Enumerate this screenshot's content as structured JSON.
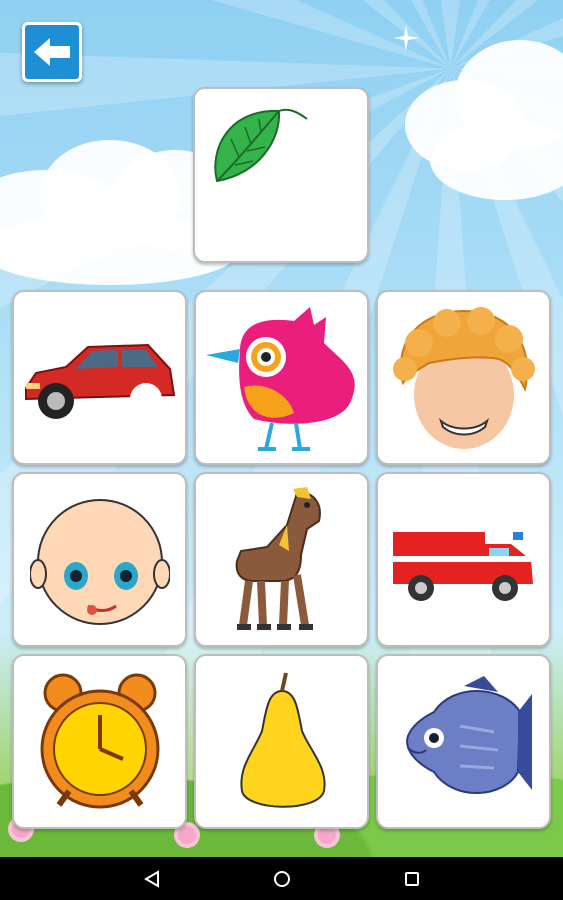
{
  "screen": {
    "background": "sky-with-clouds",
    "accent_color": "#1e8fd5",
    "back_icon": "arrow-left-icon"
  },
  "target_card": {
    "picture": "leaf",
    "color": "#34b24a"
  },
  "choices": [
    {
      "picture": "red-car",
      "color": "#d42a26"
    },
    {
      "picture": "pink-bird",
      "color": "#ea1e7d"
    },
    {
      "picture": "curly-hair-boy-face",
      "color": "#f0a53a"
    },
    {
      "picture": "bald-baby-face",
      "color": "#ffd8b8"
    },
    {
      "picture": "brown-horse",
      "color": "#8b5a3c"
    },
    {
      "picture": "fire-truck",
      "color": "#e52222"
    },
    {
      "picture": "alarm-clock",
      "color": "#ffd400"
    },
    {
      "picture": "yellow-pear",
      "color": "#ffd41e"
    },
    {
      "picture": "blue-fish",
      "color": "#6c7fc4"
    }
  ],
  "nav": {
    "back": "nav-back-icon",
    "home": "nav-home-icon",
    "recents": "nav-recents-icon"
  }
}
